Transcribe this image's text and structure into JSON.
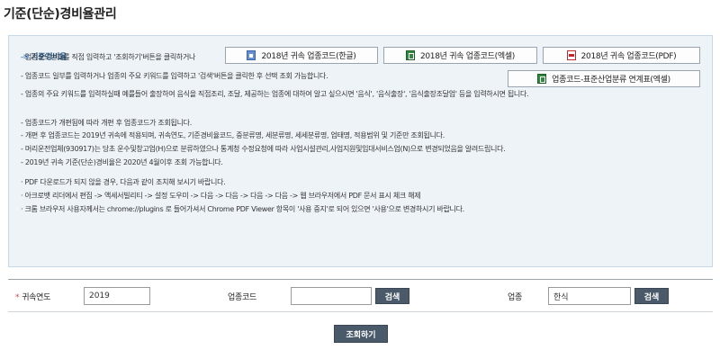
{
  "page_title": "기준(단순)경비율관리",
  "section": {
    "mark": "※",
    "label": "기준경비율"
  },
  "downloads": {
    "hwp": "2018년 귀속 업종코드(한글)",
    "excel": "2018년 귀속 업종코드(엑셀)",
    "pdf": "2018년 귀속 업종코드(PDF)",
    "mapping": "업종코드-표준산업분류 연계표(엑셀)"
  },
  "notes": [
    "- 업종코드번호를 직접 입력하고 '조회하기'버튼을 클릭하거나",
    "- 업종코드 일부를 입력하거나 업종의 주요 키워드를 입력하고 '검색'버튼을 클릭한 후 선택 조회 가능합니다.",
    "- 업종의 주요 키워드를 입력하실때 예를들어 출장하여 음식을 직접조리, 조달, 제공하는 업종에 대하여 알고 싶으시면 '음식', '음식출장', '음식출장조달업' 등을 입력하시면 됩니다.",
    "- 업종코드가 개편됨에 따라 개편 후 업종코드가 조회됩니다.",
    "- 개편 후 업종코드는 2019년 귀속에 적용되며, 귀속연도, 기준경비율코드, 중분류명, 세분류명, 세세분류명, 업태명, 적용범위 및 기준만 조회됩니다.",
    "- 머리운전업체(930917)는 당초 운수및창고업(H)으로 분류하였으나 통계청 수정요청에 따라 사업시설관리,사업지원및임대서비스업(N)으로 변경되었음을 알려드립니다.",
    "- 2019년 귀속 기준(단순)경비율은 2020년 4월이후 조회 가능합니다.",
    "· PDF 다운로드가 되지 않을 경우, 다음과 같이 조치해 보시기 바랍니다.",
    "· 아크로뱃 리더에서 편집 -> 액세서빌리티 -> 설정 도우미 -> 다음 -> 다음 -> 다음 -> 다음 -> 웹 브라우저에서 PDF 문서 표시 체크 해제",
    "· 크롬 브라우저 사용자께서는 chrome://plugins 로 들어가셔서 Chrome PDF Viewer 항목이 '사용 중지'로 되어 있으면 '사용'으로 변경하시기 바랍니다."
  ],
  "search": {
    "required_mark": "*",
    "year_label": "귀속연도",
    "year_value": "2019",
    "code_label": "업종코드",
    "code_value": "",
    "code_search": "검색",
    "industry_label": "업종",
    "industry_value": "한식",
    "industry_search": "검색"
  },
  "query_button": "조회하기"
}
